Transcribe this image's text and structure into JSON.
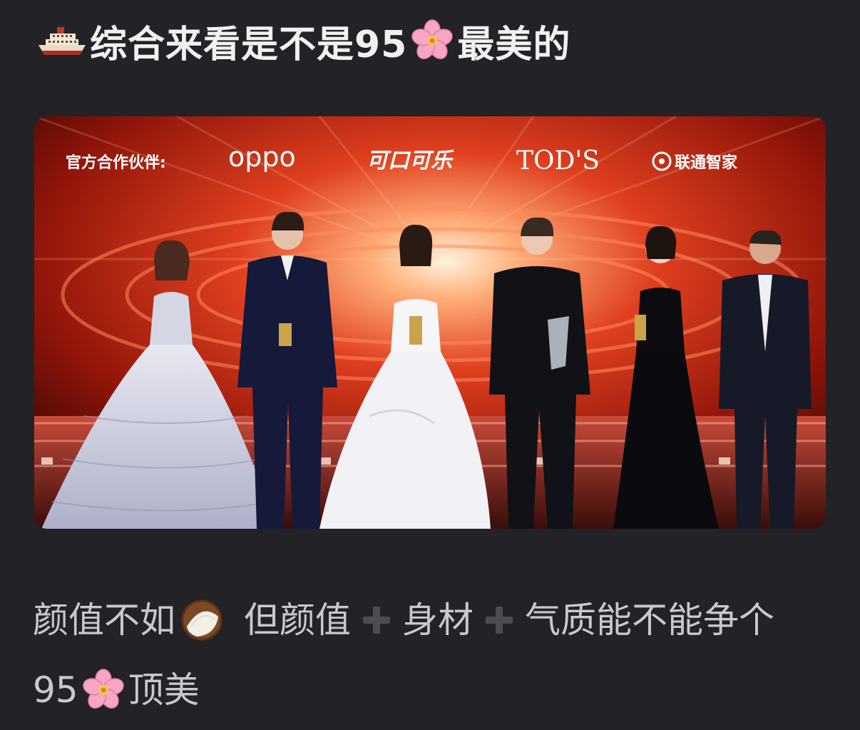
{
  "post": {
    "title_prefix": "综合来看是不是95",
    "title_suffix": "最美的",
    "body_line1_part1": "颜值不如",
    "body_line1_part2": "但颜值",
    "body_line1_part3": "身材",
    "body_line1_part4": "气质能不能争个",
    "body_line2_prefix": "95",
    "body_line2_suffix": "顶美"
  },
  "photo": {
    "partner_label": "官方合作伙伴:",
    "sponsors": [
      "oppo",
      "可口可乐",
      "TOD'S",
      "联通智家"
    ]
  },
  "icons": {
    "ship": "ship-emoji",
    "blossom": "cherry-blossom-emoji",
    "coconut": "coconut-emoji",
    "plus": "heavy-plus-sign"
  },
  "colors": {
    "background": "#232226",
    "title_text": "#f1f1f3",
    "body_text": "#c9c8cd",
    "stage_red": "#c62414"
  }
}
